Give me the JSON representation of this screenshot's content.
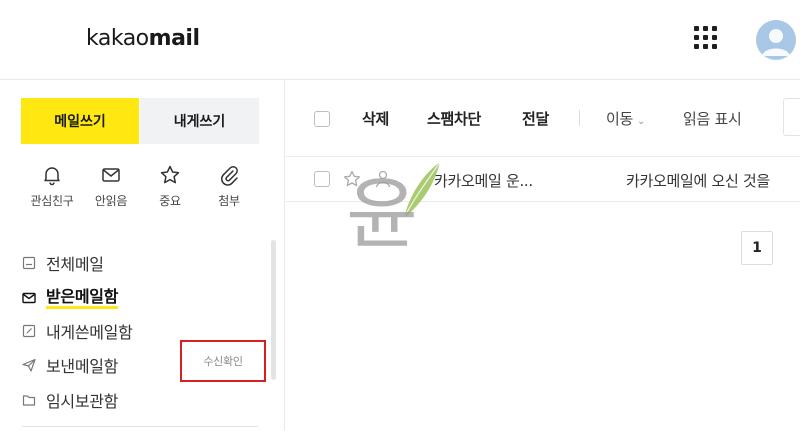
{
  "header": {
    "logo_light": "kakao",
    "logo_bold": "mail"
  },
  "sidebar": {
    "compose_label": "메일쓰기",
    "self_compose_label": "내게쓰기",
    "quick_filters": [
      {
        "label": "관심친구",
        "icon": "bell-icon"
      },
      {
        "label": "안읽음",
        "icon": "envelope-icon"
      },
      {
        "label": "중요",
        "icon": "star-icon"
      },
      {
        "label": "첨부",
        "icon": "paperclip-icon"
      }
    ],
    "folders": [
      {
        "label": "전체메일",
        "icon": "all-mail-icon",
        "active": false
      },
      {
        "label": "받은메일함",
        "icon": "inbox-icon",
        "active": true
      },
      {
        "label": "내게쓴메일함",
        "icon": "self-mail-icon",
        "active": false
      },
      {
        "label": "보낸메일함",
        "icon": "send-icon",
        "active": false
      },
      {
        "label": "임시보관함",
        "icon": "folder-icon",
        "active": false
      }
    ],
    "read_receipt_label": "수신확인"
  },
  "toolbar": {
    "delete_label": "삭제",
    "block_spam_label": "스팸차단",
    "forward_label": "전달",
    "move_label": "이동",
    "mark_read_label": "읽음 표시"
  },
  "mail_list": [
    {
      "sender": "카카오메일 운...",
      "subject": "카카오메일에 오신 것을"
    }
  ],
  "pagination": {
    "current_page": "1"
  },
  "watermark": {
    "text": "윤"
  },
  "colors": {
    "accent_yellow": "#ffe812",
    "highlight_red": "#d62020",
    "watermark_green": "#9cc25a"
  }
}
